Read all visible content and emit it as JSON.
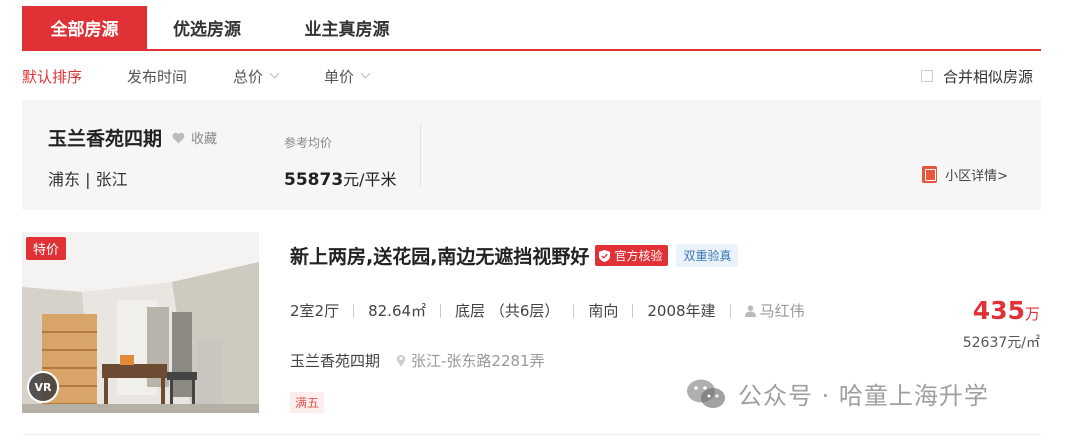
{
  "tabs": [
    {
      "label": "全部房源",
      "active": true
    },
    {
      "label": "优选房源",
      "active": false
    },
    {
      "label": "业主真房源",
      "active": false
    }
  ],
  "sort": {
    "default": "默认排序",
    "time": "发布时间",
    "total": "总价",
    "unit": "单价",
    "merge": "合并相似房源"
  },
  "community": {
    "name": "玉兰香苑四期",
    "favorite": "收藏",
    "location": "浦东 | 张江",
    "ref_label": "参考均价",
    "ref_price": "55873",
    "ref_unit": "元/平米",
    "detail_link": "小区详情>"
  },
  "listing": {
    "special_tag": "特价",
    "vr": "VR",
    "title": "新上两房,送花园,南边无遮挡视野好",
    "badge_official": "官方核验",
    "badge_double": "双重验真",
    "layout": "2室2厅",
    "area": "82.64㎡",
    "floor": "底层 （共6层）",
    "orientation": "南向",
    "built": "2008年建",
    "agent": "马红伟",
    "community": "玉兰香苑四期",
    "address": "张江-张东路2281弄",
    "tag": "满五",
    "price_total": "435",
    "price_total_unit": "万",
    "price_unit": "52637元/㎡"
  },
  "watermark": "公众号 · 哈童上海升学",
  "colors": {
    "accent": "#e03236",
    "panel": "#f6f6f6",
    "double_badge": "#3c78b5"
  }
}
